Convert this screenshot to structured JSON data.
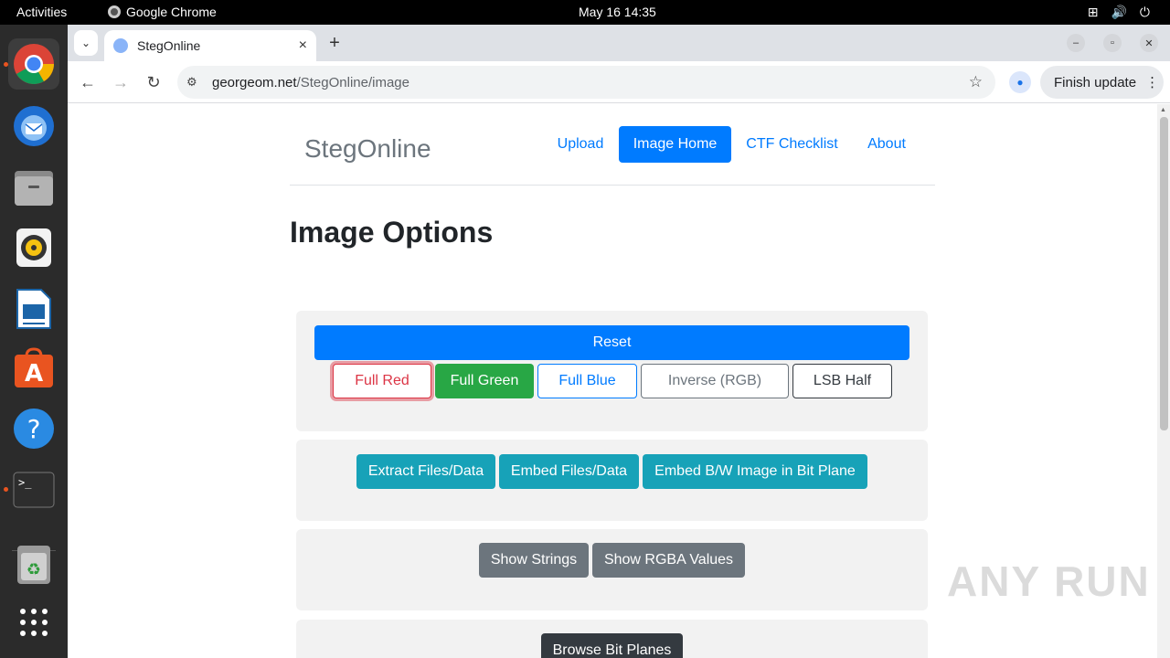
{
  "system_bar": {
    "activities": "Activities",
    "app_name": "Google Chrome",
    "clock": "May 16  14:35"
  },
  "dock": {
    "items": [
      "Google Chrome",
      "Thunderbird Mail",
      "Files",
      "Rhythmbox",
      "LibreOffice Writer",
      "Ubuntu Software",
      "Help",
      "Terminal",
      "Trash",
      "Show Applications"
    ]
  },
  "browser": {
    "tab_title": "StegOnline",
    "url_host": "georgeom.net",
    "url_path": "/StegOnline/image",
    "finish_update": "Finish update"
  },
  "page": {
    "brand": "StegOnline",
    "nav": [
      "Upload",
      "Image Home",
      "CTF Checklist",
      "About"
    ],
    "active_nav": "Image Home",
    "heading": "Image Options",
    "card1": {
      "reset": "Reset",
      "buttons": [
        "Full Red",
        "Full Green",
        "Full Blue",
        "Inverse (RGB)",
        "LSB Half"
      ]
    },
    "card2": {
      "buttons": [
        "Extract Files/Data",
        "Embed Files/Data",
        "Embed B/W Image in Bit Plane"
      ]
    },
    "card3": {
      "buttons": [
        "Show Strings",
        "Show RGBA Values"
      ]
    },
    "card4": {
      "buttons": [
        "Browse Bit Planes"
      ]
    }
  },
  "watermark": "ANY RUN",
  "colors": {
    "primary": "#007bff",
    "success": "#28a745",
    "danger": "#dc3545",
    "info": "#17a2b8",
    "secondary": "#6c757d",
    "dark": "#343a40"
  }
}
